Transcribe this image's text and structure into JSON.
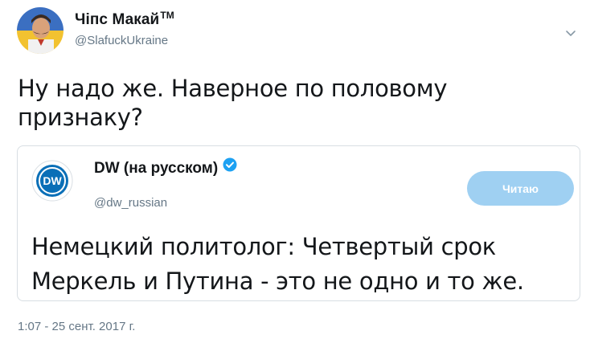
{
  "author": {
    "display_name": "Чіпс Макай",
    "trademark": "TM",
    "handle": "@SlafuckUkraine",
    "avatar_icon": "avatar-mustache-man-ukraine-flag"
  },
  "menu_icon": "chevron-down-icon",
  "tweet": {
    "text_line1": "Ну надо же. Наверное по половому",
    "text_line2": "признаку?"
  },
  "quoted_tweet": {
    "display_name": "DW (на русском)",
    "verified_icon": "verified-badge-icon",
    "handle": "@dw_russian",
    "logo_icon": "dw-logo-icon",
    "follow_button_label": "Читаю",
    "text_line1": "Немецкий политолог: Четвертый срок",
    "text_line2": "Меркель и Путина - это не одно и то же."
  },
  "timestamp": "1:07 - 25 сент. 2017 г.",
  "colors": {
    "text_primary": "#14171a",
    "text_secondary": "#657786",
    "border": "#d8dee3",
    "follow_button": "#9fd0f2",
    "verified": "#1da1f2",
    "dw_blue": "#0a6fb7"
  }
}
